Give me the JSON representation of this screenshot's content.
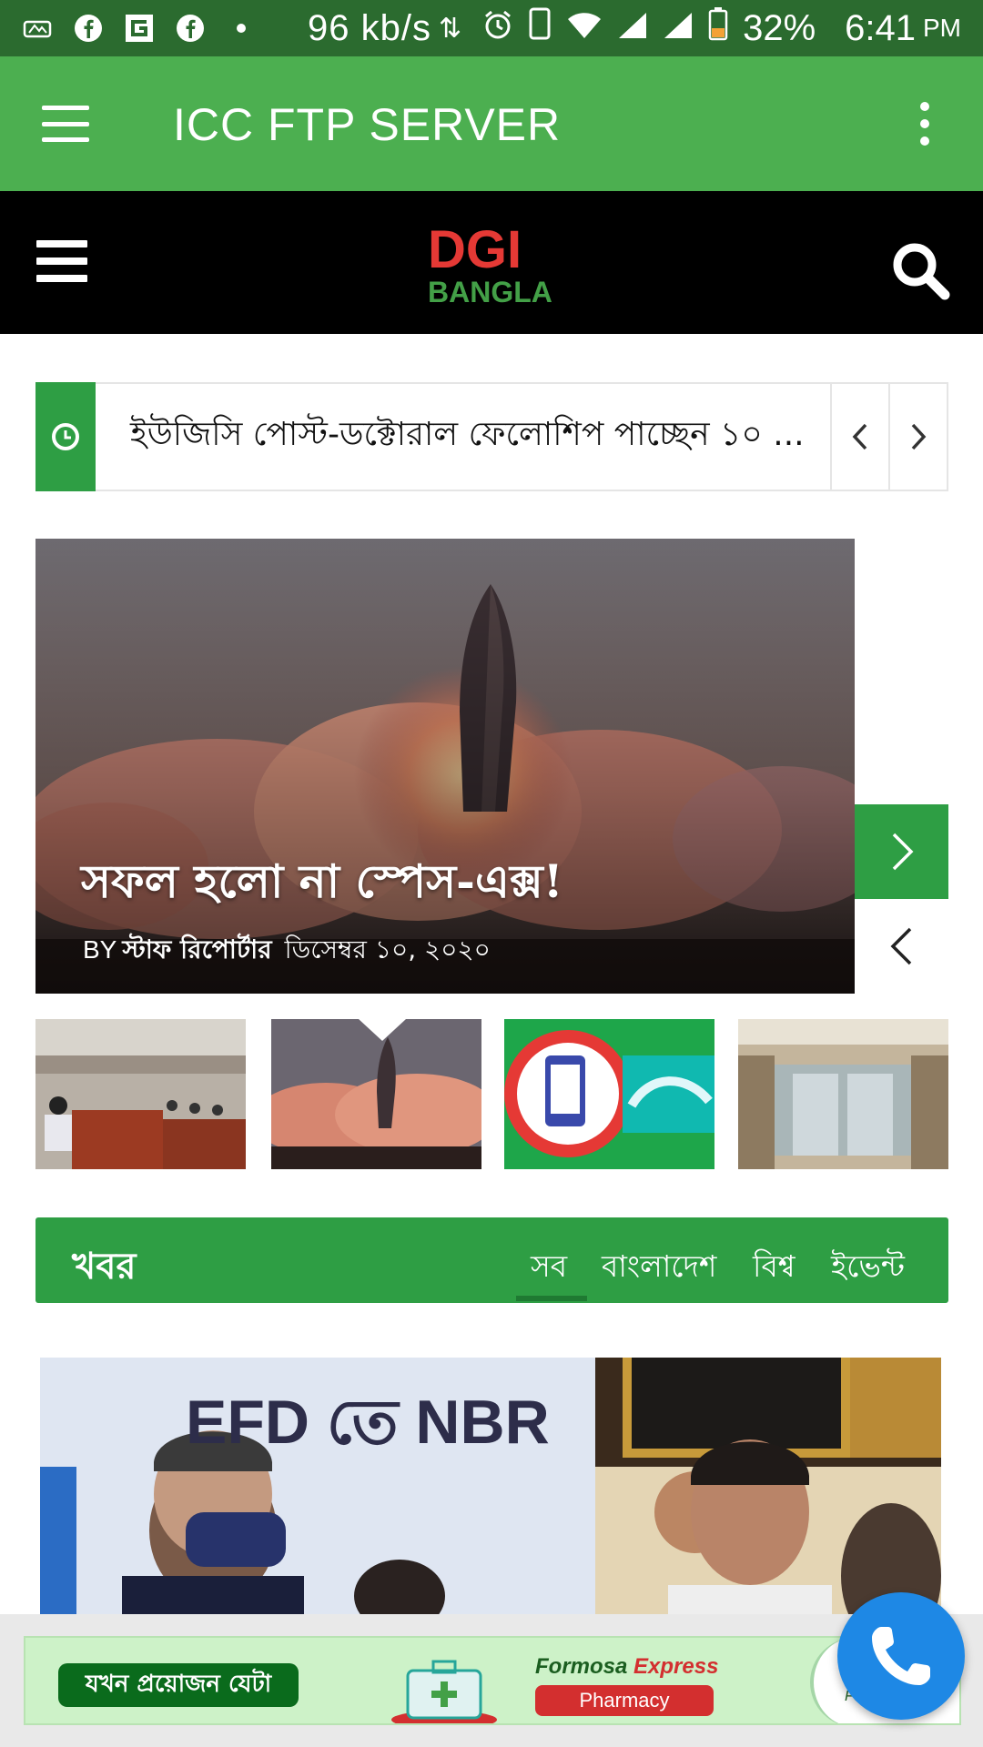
{
  "status_bar": {
    "speed": "96 kb/s",
    "battery": "32%",
    "time": "6:41",
    "ampm": "PM"
  },
  "app_bar": {
    "title": "ICC FTP SERVER"
  },
  "site_header": {
    "logo_top": "DGI",
    "logo_bottom": "BANGLA"
  },
  "ticker": {
    "headline": "ইউজিসি পোস্ট-ডক্টোরাল ফেলোশিপ পাচ্ছেন ১০ ..."
  },
  "hero": {
    "title": "সফল হলো না স্পেস-এক্স!",
    "by": "BY",
    "author": "স্টাফ রিপোর্টার",
    "date": "ডিসেম্বর ১০, ২০২০"
  },
  "news": {
    "section_title": "খবর",
    "tabs": [
      "সব",
      "বাংলাদেশ",
      "বিশ্ব",
      "ইভেন্ট"
    ]
  },
  "article": {
    "image_text": "EFD তে NBR"
  },
  "ad": {
    "tagline": "যখন প্রয়োজন যেটা",
    "brand_prefix": "Formosa ",
    "brand_accent": "Express",
    "pharmacy": "Pharmacy",
    "end_text": "For"
  },
  "colors": {
    "status_bar": "#2b6b2f",
    "app_bar": "#4caf50",
    "accent_green": "#2e9e44",
    "call_button": "#1e88e5"
  }
}
